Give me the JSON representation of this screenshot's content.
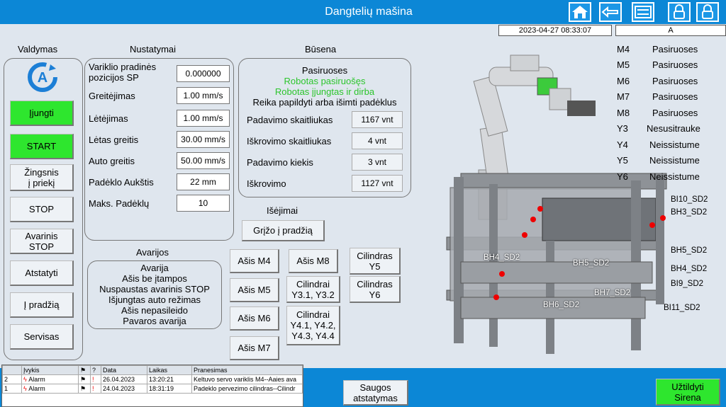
{
  "header": {
    "title": "Dangtelių mašina",
    "datetime": "2023-04-27 08:33:07",
    "user": "A"
  },
  "control": {
    "title": "Valdymas",
    "buttons": [
      "Įjungti",
      "START",
      "Žingsnis\nį priekį",
      "STOP",
      "Avarinis\nSTOP",
      "Atstatyti",
      "Į pradžią",
      "Servisas"
    ]
  },
  "settings": {
    "title": "Nustatymai",
    "rows": [
      {
        "label": "Variklio pradinės pozicijos SP",
        "value": "0.000000 mm"
      },
      {
        "label": "Greitėjimas",
        "value": "1.00 mm/s"
      },
      {
        "label": "Lėtėjimas",
        "value": "1.00 mm/s"
      },
      {
        "label": "Lėtas greitis",
        "value": "30.00 mm/s"
      },
      {
        "label": "Auto greitis",
        "value": "50.00 mm/s"
      },
      {
        "label": "Padėklo Aukštis",
        "value": "22 mm"
      },
      {
        "label": "Maks. Padėklų",
        "value": "10"
      }
    ]
  },
  "status": {
    "title": "Būsena",
    "lines": [
      "Pasiruoses",
      "Robotas pasiruošęs",
      "Robotas įjungtas ir dirba",
      "Reika papildyti arba išimti padėklus"
    ],
    "counters": [
      {
        "label": "Padavimo skaitliukas",
        "value": "1167 vnt"
      },
      {
        "label": "Iškrovimo skaitliukas",
        "value": "4 vnt"
      },
      {
        "label": "Padavimo kiekis",
        "value": "3 vnt"
      },
      {
        "label": "Iškrovimo",
        "value": "1127 vnt"
      }
    ]
  },
  "outputs": {
    "title": "Išėjimai",
    "return_button": "Grįžo į pradžią",
    "buttons": [
      "Ašis M4",
      "Ašis M8",
      "Cilindras\nY5",
      "Ašis M5",
      "Cilindrai\nY3.1, Y3.2",
      "Cilindras\nY6",
      "Ašis M6",
      "Cilindrai\nY4.1, Y4.2,\nY4.3, Y4.4",
      "Ašis M7"
    ]
  },
  "alarms": {
    "title": "Avarijos",
    "lines": [
      "Avarija",
      "Ašis be įtampos",
      "Nuspaustas avarinis STOP",
      "Išjungtas auto režimas",
      "Ašis nepasileido",
      "Pavaros avarija"
    ]
  },
  "motors": [
    {
      "name": "M4",
      "state": "Pasiruoses"
    },
    {
      "name": "M5",
      "state": "Pasiruoses"
    },
    {
      "name": "M6",
      "state": "Pasiruoses"
    },
    {
      "name": "M7",
      "state": "Pasiruoses"
    },
    {
      "name": "M8",
      "state": "Pasiruoses"
    },
    {
      "name": "Y3",
      "state": "Nesusitrauke"
    },
    {
      "name": "Y4",
      "state": "Neissistume"
    },
    {
      "name": "Y5",
      "state": "Neissistume"
    },
    {
      "name": "Y6",
      "state": "Neissistume"
    }
  ],
  "sensors": [
    "BI10_SD2",
    "BH3_SD2",
    "BH5_SD2",
    "BH4_SD2",
    "BI9_SD2",
    "BI11_SD2",
    "BH4_SD2",
    "BH5_SD2",
    "BH7_SD2",
    "BH6_SD2"
  ],
  "alarm_log": {
    "columns": [
      "",
      "Įvykis",
      "",
      "?",
      "Data",
      "Laikas",
      "Pranesimas"
    ],
    "rows": [
      {
        "n": "2",
        "event": "Alarm",
        "date": "26.04.2023",
        "time": "13:20:21",
        "msg": "Keltuvo servo variklis M4--Aaies ava"
      },
      {
        "n": "1",
        "event": "Alarm",
        "date": "24.04.2023",
        "time": "18:31:19",
        "msg": "Padeklo pervezimo cilindras--Cilindr"
      }
    ]
  },
  "bottom": {
    "reset_safety": "Saugos\natstatymas",
    "siren": "Užtildyti\nSirena"
  },
  "icons": [
    "home-icon",
    "back-icon",
    "settings-icon",
    "lock-icon",
    "lock-icon"
  ],
  "colors": {
    "bar": "#0c87d6",
    "green": "#2ee62e",
    "status_green": "#2cc52c"
  }
}
